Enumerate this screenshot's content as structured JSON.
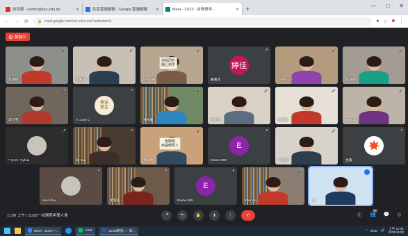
{
  "browser": {
    "tabs": [
      {
        "label": "收件匣 - admin@ksu.edu.tw",
        "favicon_color": "#d93025"
      },
      {
        "label": "共享雲端硬碟 - Google 雲端硬碟",
        "favicon_color": "#1a73e8"
      },
      {
        "label": "Meet - 11/23 - 台灣青年...",
        "favicon_color": "#00897b",
        "active": true
      }
    ],
    "new_tab": "+",
    "window_controls": [
      "—",
      "□",
      "✕"
    ],
    "address": "meet.google.com/xxx-xxxx-xxx?authuser=0",
    "nav": [
      "←",
      "→",
      "⟳"
    ]
  },
  "meet": {
    "recording_label": "錄製中",
    "tiles": [
      {
        "name": "台灣林",
        "kind": "video",
        "wall": "#8c8f8a",
        "shirt": "#c0392b"
      },
      {
        "name": "徐麗珠",
        "kind": "video",
        "wall": "#c7c1b5",
        "shirt": "#2c3e50"
      },
      {
        "name": "Ellen 陳",
        "kind": "video",
        "wall": "#b7a68f",
        "shirt": "#7a5a48",
        "sign": "你我同在\n關心到中"
      },
      {
        "name": "羅嘉佳",
        "kind": "avatar",
        "avatar_text": "婷佳",
        "avatar_color": "#c2185b"
      },
      {
        "name": "Aileen Lin",
        "kind": "video",
        "wall": "#b49b7e",
        "shirt": "#8e44ad"
      },
      {
        "name": "蔡 陳佳",
        "kind": "video",
        "wall": "#a39c95",
        "shirt": "#16a085"
      },
      {
        "name": "郭小雪",
        "kind": "video",
        "wall": "#70665b",
        "shirt": "#b03a2e"
      },
      {
        "name": "YI.JON C",
        "kind": "logo",
        "logo_text": "善益\n基金"
      },
      {
        "name": "林秋蘭",
        "kind": "video",
        "wall": "#6f8a64",
        "shirt": "#2e86c1",
        "shelf": true
      },
      {
        "name": "林光芝",
        "kind": "video",
        "wall": "#d9d1c5",
        "shirt": "#5d6d7e"
      },
      {
        "name": "張淑敏",
        "kind": "video",
        "wall": "#e6e0d6",
        "shirt": "#c0392b"
      },
      {
        "name": "Meg.Lin",
        "kind": "video",
        "wall": "#bdb3a6",
        "shirt": "#6c3483"
      },
      {
        "name": "* YuYu *Sylvia",
        "kind": "photo",
        "wall": "#2d2d2d"
      },
      {
        "name": "lily tsai",
        "kind": "video",
        "wall": "#4a3b30",
        "shirt": "#3b2f28",
        "shelf": true
      },
      {
        "name": "黃郁玲",
        "kind": "video",
        "wall": "#c9a27b",
        "shirt": "#34495e",
        "sign": "用關懷\n用溫暖照人"
      },
      {
        "name": "Elaine 888",
        "kind": "avatar",
        "avatar_text": "E",
        "avatar_color": "#8e24aa"
      },
      {
        "name": "千淑如",
        "kind": "video",
        "wall": "#d8d3ca",
        "shirt": "#2c3e50"
      },
      {
        "name": "金嘉",
        "kind": "logo_leaf"
      },
      {
        "name": "ariel chiu",
        "kind": "photo",
        "wall": "#5a4b44"
      },
      {
        "name": "葉淑美",
        "kind": "video",
        "wall": "#6d5a49",
        "shirt": "#7b241c",
        "shelf": true
      },
      {
        "name": "Elaine 888",
        "kind": "avatar",
        "avatar_text": "E",
        "avatar_color": "#8e24aa"
      },
      {
        "name": "York Lin",
        "kind": "video",
        "wall": "#8b7f74",
        "shirt": "#c0392b",
        "shelf": true
      },
      {
        "name": "你",
        "kind": "video",
        "wall": "#cfe3f2",
        "shirt": "#1f3a5f",
        "speaking": true
      }
    ]
  },
  "bottombar": {
    "time_meeting": "11:06 上午  |  11/23一台灣青年學人會",
    "controls": [
      "🎤",
      "📷",
      "✋",
      "⬆",
      "⋮"
    ],
    "end_call": "✆",
    "right_icons": [
      "ⓘ",
      "👥",
      "💬",
      "◇"
    ],
    "participants_count": "24"
  },
  "taskbar": {
    "apps": [
      {
        "label": "Meet - 11/23一...",
        "color": "#4285f4"
      },
      {
        "label": "LINE",
        "color": "#06c755"
      },
      {
        "label": "12/19研習... - 家...",
        "color": "#2b579a"
      }
    ],
    "tray": [
      "^",
      "ENG",
      "🔊"
    ],
    "time": "上午 11:06",
    "date": "2021/11/23"
  }
}
